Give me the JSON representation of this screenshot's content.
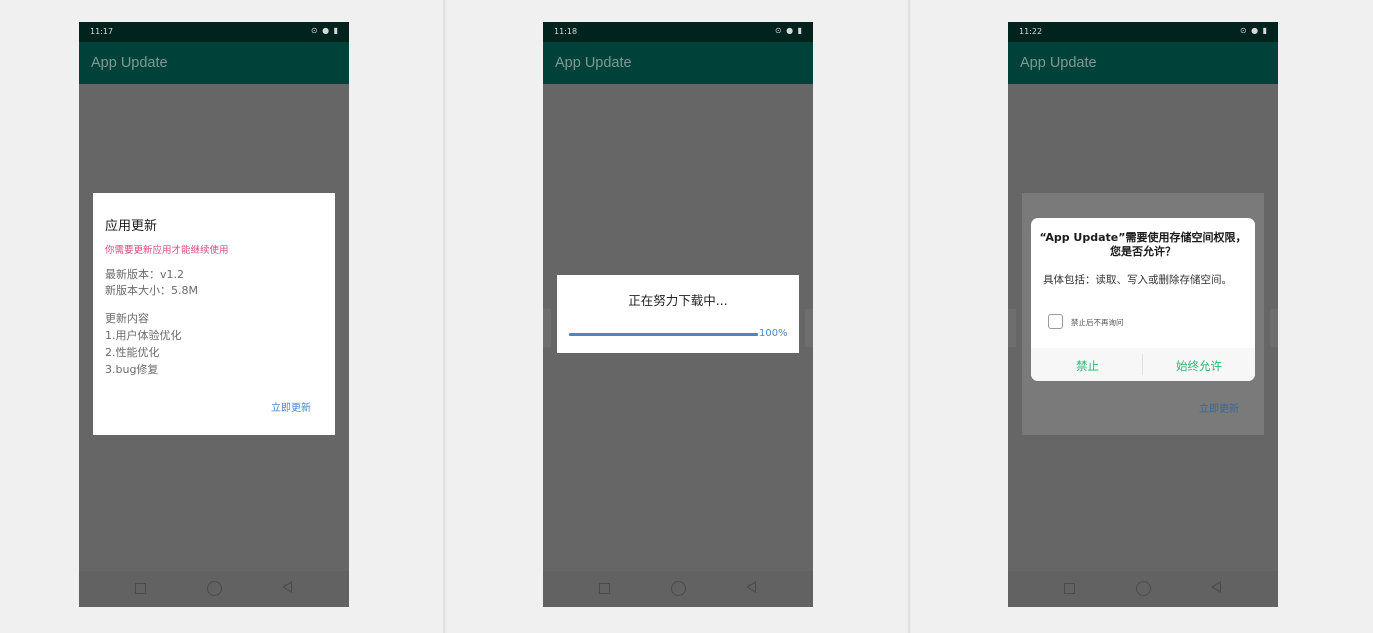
{
  "screens": [
    {
      "status_time": "11:17",
      "status_icons": "⊙ ● ▮",
      "app_title": "App Update",
      "dialog": {
        "title": "应用更新",
        "subtitle": "你需要更新应用才能继续使用",
        "version": "最新版本：v1.2",
        "size": "新版本大小：5.8M",
        "content_header": "更新内容",
        "item1": "1.用户体验优化",
        "item2": "2.性能优化",
        "item3": "3.bug修复",
        "action": "立即更新"
      }
    },
    {
      "status_time": "11:18",
      "status_icons": "⊙ ● ▮",
      "app_title": "App Update",
      "dialog": {
        "title": "正在努力下载中...",
        "progress_percent": 100,
        "progress_label": "100%"
      }
    },
    {
      "status_time": "11:22",
      "status_icons": "⊙ ● ▮",
      "app_title": "App Update",
      "background_action": "立即更新",
      "permission": {
        "title_line1": "“App Update”需要使用存储空间权限，",
        "title_line2": "您是否允许？",
        "desc": "具体包括：读取、写入或删除存储空间。",
        "checkbox_label": "禁止后不再询问",
        "deny": "禁止",
        "allow": "始终允许"
      }
    }
  ],
  "colors": {
    "status_bar": "#00231d",
    "toolbar": "#00413a",
    "accent_blue": "#4a86c8",
    "accent_pink": "#d84c7e",
    "accent_green": "#2bb673"
  },
  "icons": [
    "square-nav-icon",
    "circle-nav-icon",
    "back-nav-icon",
    "wifi-icon",
    "battery-icon"
  ]
}
